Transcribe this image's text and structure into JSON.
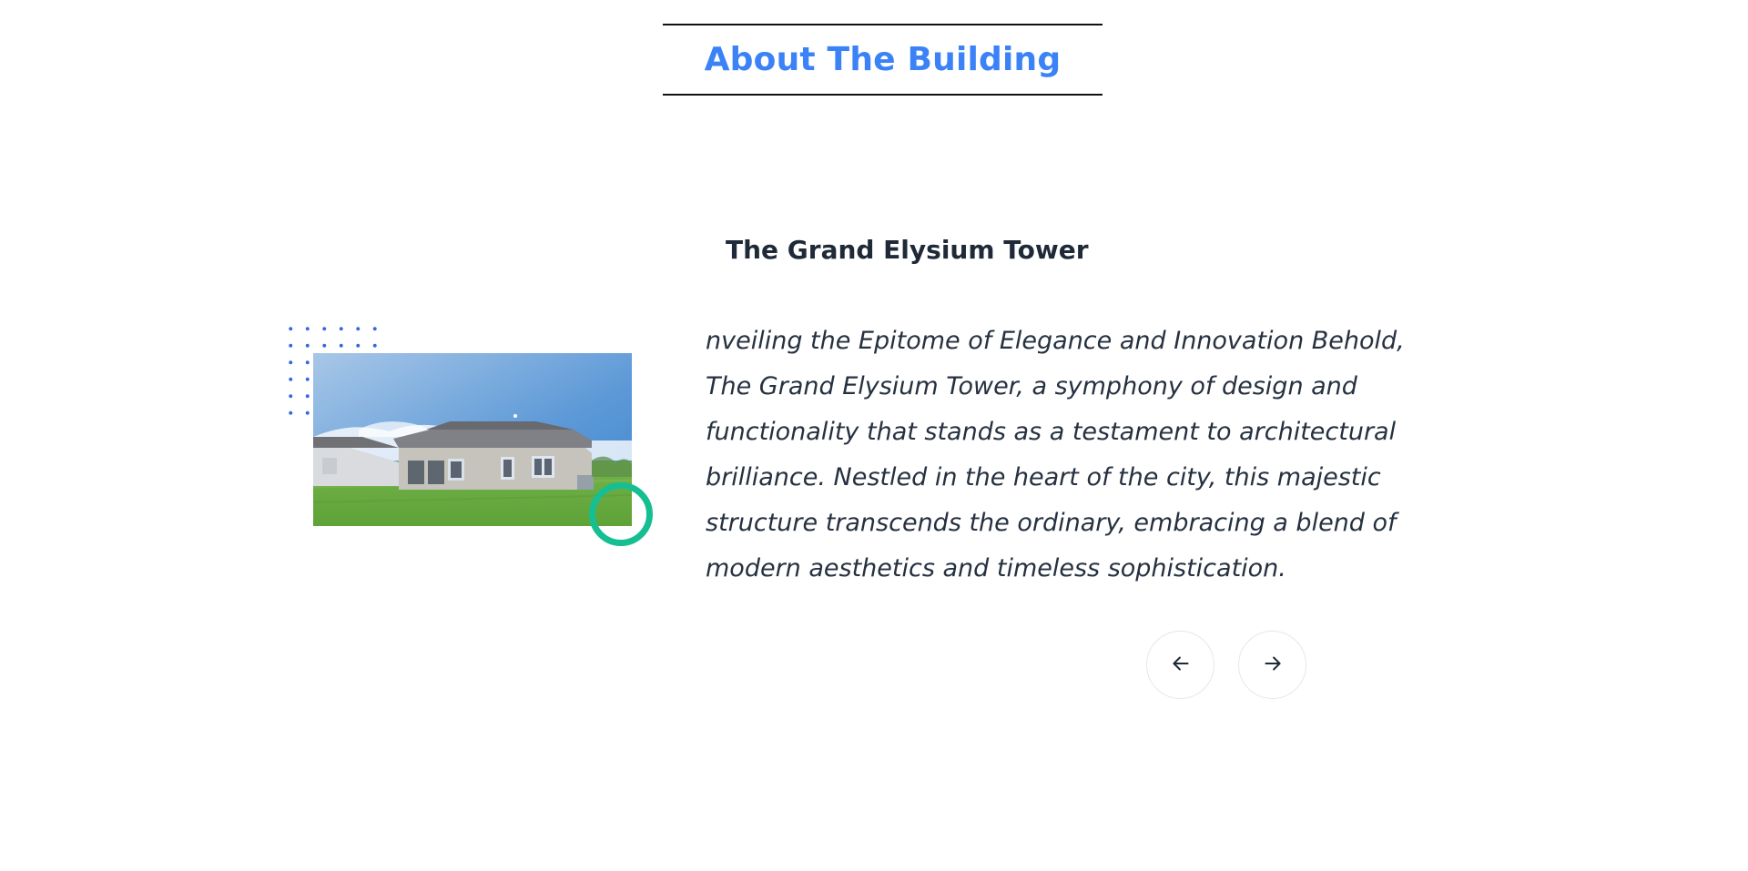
{
  "header": {
    "title": "About The Building",
    "title_color": "#3b82f6"
  },
  "slide": {
    "title": "The Grand Elysium Tower",
    "description": "nveiling the Epitome of Elegance and Innovation Behold, The Grand Elysium Tower, a symphony of design and functionality that stands as a testament to architectural brilliance. Nestled in the heart of the city, this majestic structure transcends the ordinary, embracing a blend of modern aesthetics and timeless sophistication.",
    "image_alt": "Single-story house with lawn under blue sky"
  },
  "decorations": {
    "dots_color": "#2f5fe0",
    "ring_color": "#16bf91"
  },
  "navigation": {
    "prev_icon": "arrow-left-icon",
    "next_icon": "arrow-right-icon"
  }
}
